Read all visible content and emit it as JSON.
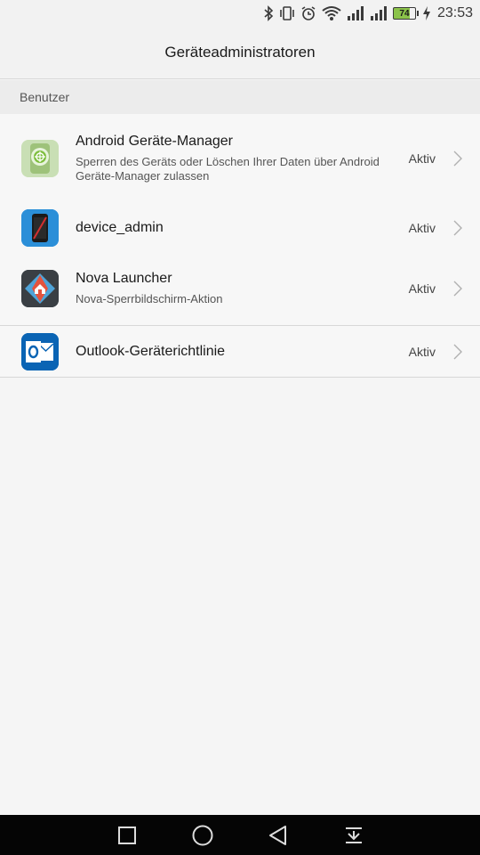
{
  "status_bar": {
    "time": "23:53",
    "battery_level": "74",
    "icons": [
      "bluetooth-icon",
      "vibrate-icon",
      "alarm-icon",
      "wifi-icon",
      "signal-icon",
      "signal-icon",
      "battery-icon",
      "charging-icon"
    ]
  },
  "app_bar": {
    "title": "Geräteadministratoren"
  },
  "section": {
    "label": "Benutzer"
  },
  "items": [
    {
      "title": "Android Geräte-Manager",
      "subtitle": "Sperren des Geräts oder Löschen Ihrer Daten über Android Geräte-Manager zulassen",
      "status": "Aktiv",
      "icon": "android-device-manager-icon"
    },
    {
      "title": "device_admin",
      "subtitle": "",
      "status": "Aktiv",
      "icon": "device-admin-icon"
    },
    {
      "title": "Nova Launcher",
      "subtitle": "Nova-Sperrbildschirm-Aktion",
      "status": "Aktiv",
      "icon": "nova-launcher-icon"
    },
    {
      "title": "Outlook-Geräterichtlinie",
      "subtitle": "",
      "status": "Aktiv",
      "icon": "outlook-icon"
    }
  ],
  "nav_bar": {
    "buttons": [
      "recents-icon",
      "home-icon",
      "back-icon",
      "notification-pull-icon"
    ]
  },
  "colors": {
    "background": "#f5f5f5",
    "nav_bar": "#050505",
    "battery_fill": "#8bc34a",
    "outlook_blue": "#0a64b4"
  }
}
